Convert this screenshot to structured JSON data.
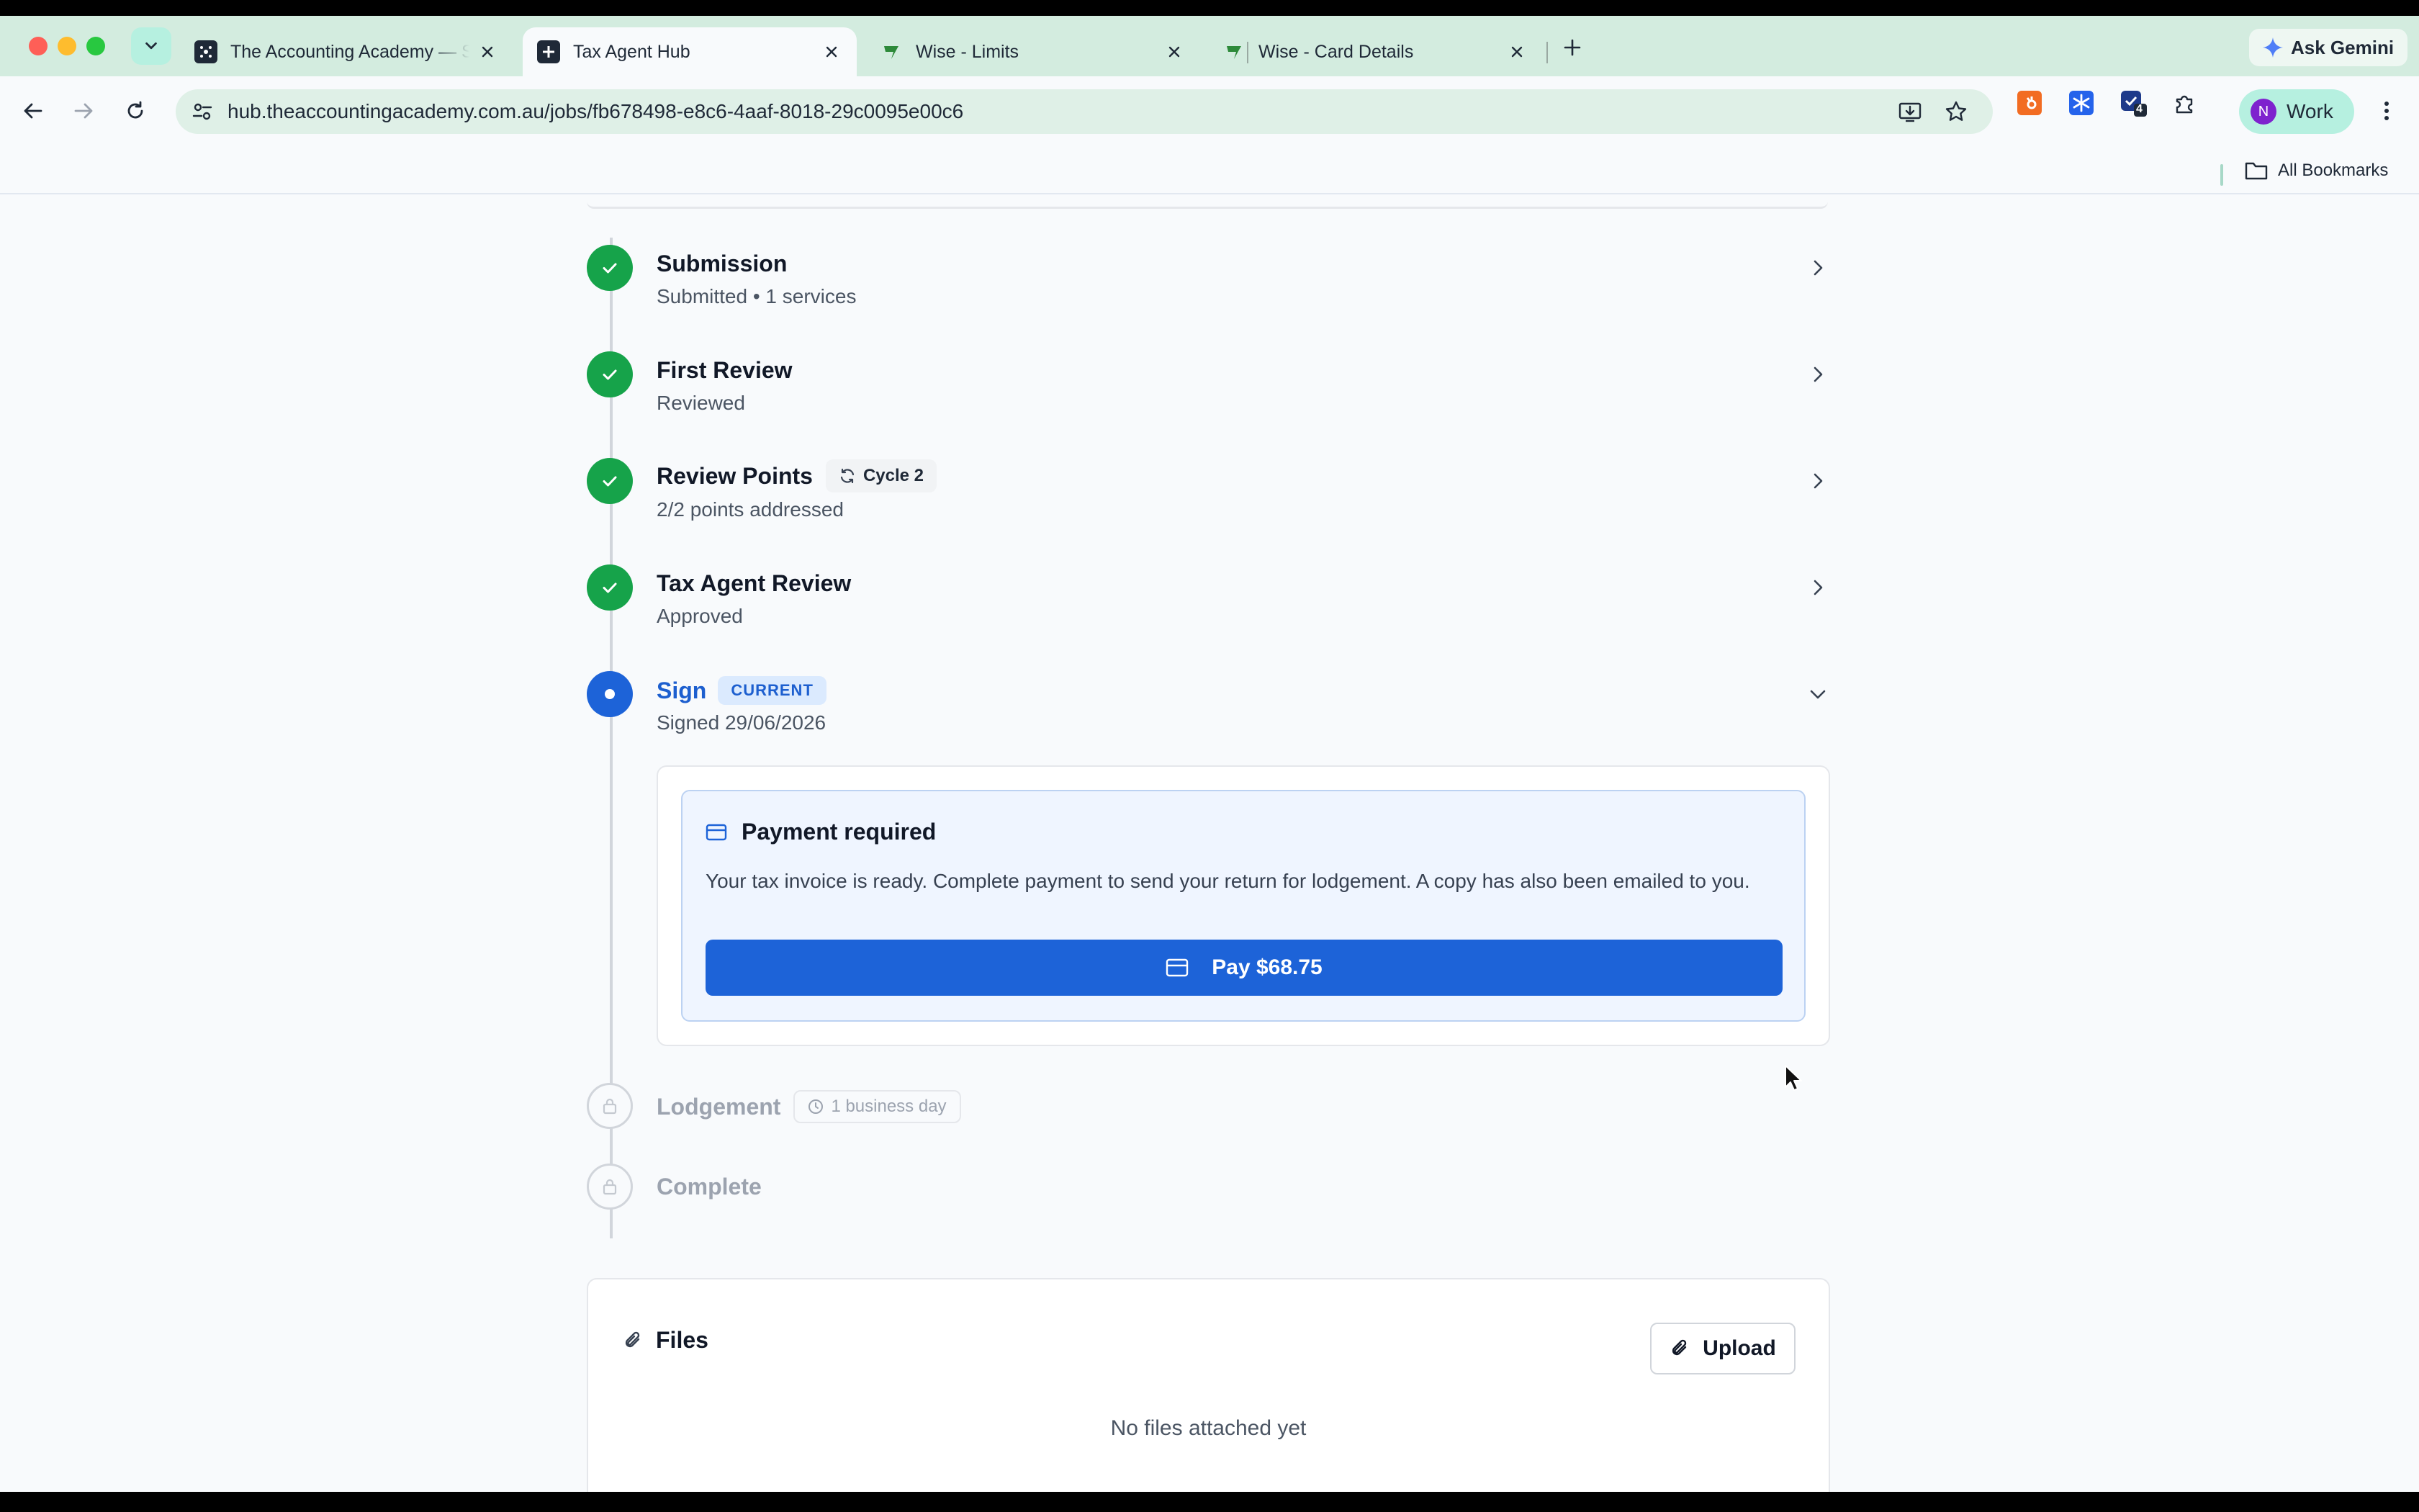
{
  "browser": {
    "tabs": [
      {
        "title": "The Accounting Academy — S",
        "active": false
      },
      {
        "title": "Tax Agent Hub",
        "active": true
      },
      {
        "title": "Wise - Limits",
        "active": false
      },
      {
        "title": "Wise - Card Details",
        "active": false
      }
    ],
    "gemini_label": "Ask Gemini",
    "url": "hub.theaccountingacademy.com.au/jobs/fb678498-e8c6-4aaf-8018-29c0095e00c6",
    "extension_badge": "4",
    "profile_initial": "N",
    "profile_label": "Work",
    "bookmarks_label": "All Bookmarks"
  },
  "steps": {
    "submission": {
      "title": "Submission",
      "subtitle": "Submitted • 1 services"
    },
    "first_review": {
      "title": "First Review",
      "subtitle": "Reviewed"
    },
    "review_points": {
      "title": "Review Points",
      "badge": "Cycle 2",
      "subtitle": "2/2 points addressed"
    },
    "tax_agent_review": {
      "title": "Tax Agent Review",
      "subtitle": "Approved"
    },
    "sign": {
      "title": "Sign",
      "badge": "CURRENT",
      "subtitle": "Signed 29/06/2026"
    },
    "lodgement": {
      "title": "Lodgement",
      "badge": "1 business day"
    },
    "complete": {
      "title": "Complete"
    }
  },
  "payment": {
    "title": "Payment required",
    "message": "Your tax invoice is ready. Complete payment to send your return for lodgement. A copy has also been emailed to you.",
    "button_label": "Pay $68.75"
  },
  "files": {
    "title": "Files",
    "upload_label": "Upload",
    "empty_text": "No files attached yet"
  },
  "colors": {
    "done": "#16a34a",
    "current": "#1d63d8",
    "locked": "#d1d5db",
    "accent_blue": "#1d5fcf"
  },
  "icons": {
    "step_done": "check-icon",
    "step_current": "dot-icon",
    "step_locked": "lock-icon",
    "payment": "credit-card-icon",
    "files": "paperclip-icon",
    "cycle": "refresh-icon",
    "lodgement_time": "clock-icon"
  }
}
